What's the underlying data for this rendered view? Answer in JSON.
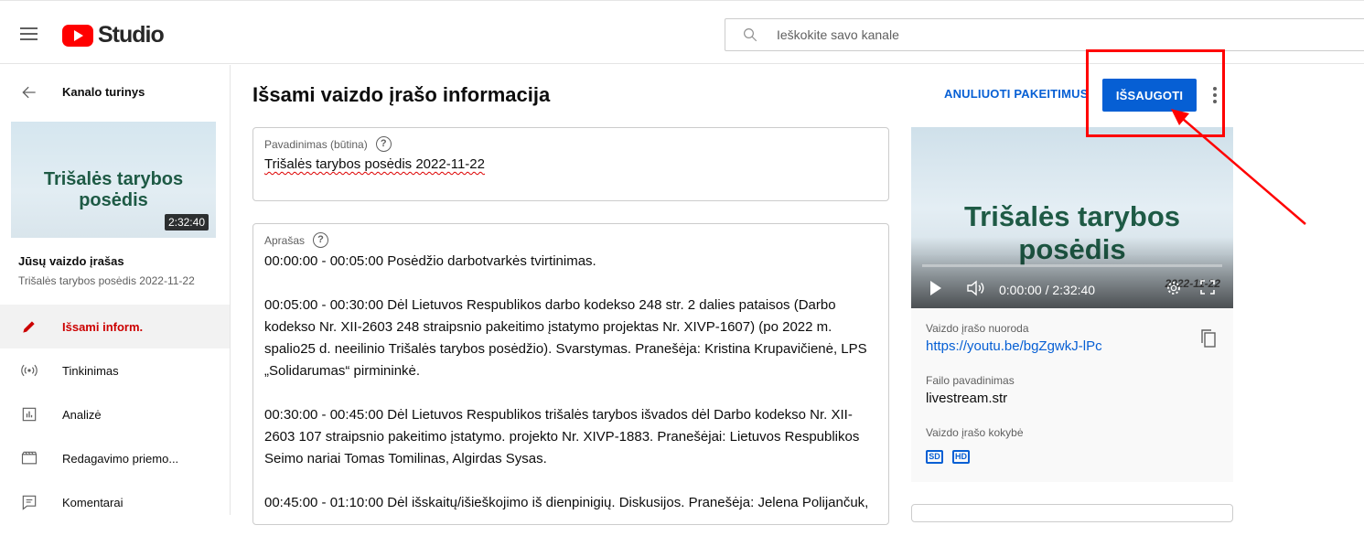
{
  "header": {
    "logo_text": "Studio",
    "search_placeholder": "Ieškokite savo kanale"
  },
  "sidebar": {
    "back_label": "Kanalo turinys",
    "thumbnail_title": "Trišalės tarybos posėdis",
    "thumbnail_duration": "2:32:40",
    "your_video_label": "Jūsų vaizdo įrašas",
    "video_title": "Trišalės tarybos posėdis 2022-11-22",
    "items": [
      {
        "label": "Išsami inform.",
        "icon": "pencil-icon",
        "active": true
      },
      {
        "label": "Tinkinimas",
        "icon": "broadcast-icon",
        "active": false
      },
      {
        "label": "Analizė",
        "icon": "analytics-icon",
        "active": false
      },
      {
        "label": "Redagavimo priemo...",
        "icon": "clapperboard-icon",
        "active": false
      },
      {
        "label": "Komentarai",
        "icon": "comment-icon",
        "active": false
      }
    ]
  },
  "main": {
    "page_title": "Išsami vaizdo įrašo informacija",
    "undo_label": "ANULIUOTI PAKEITIMUS",
    "save_label": "IŠSAUGOTI",
    "title_field": {
      "label": "Pavadinimas (būtina)",
      "value": "Trišalės tarybos posėdis 2022-11-22"
    },
    "description_field": {
      "label": "Aprašas",
      "paragraphs": [
        "00:00:00 - 00:05:00 Posėdžio darbotvarkės tvirtinimas.",
        "00:05:00 - 00:30:00 Dėl Lietuvos Respublikos darbo kodekso 248 str. 2 dalies pataisos (Darbo kodekso Nr. XII-2603 248 straipsnio pakeitimo įstatymo projektas Nr. XIVP-1607) (po 2022 m. spalio25 d. neeilinio Trišalės tarybos posėdžio). Svarstymas. Pranešėja: Kristina Krupavičienė, LPS „Solidarumas“ pirmininkė.",
        "00:30:00 - 00:45:00 Dėl Lietuvos Respublikos trišalės tarybos išvados dėl Darbo kodekso Nr. XII-2603 107 straipsnio pakeitimo įstatymo. projekto Nr. XIVP-1883. Pranešėjai: Lietuvos Respublikos Seimo nariai Tomas Tomilinas, Algirdas Sysas.",
        "00:45:00 - 01:10:00 Dėl išskaitų/išieškojimo iš dienpinigių. Diskusijos. Pranešėja: Jelena Polijančuk,"
      ]
    }
  },
  "player": {
    "video_title": "Trišalės tarybos posėdis",
    "video_date": "2022-11-22",
    "timecode": "0:00:00 / 2:32:40",
    "link_label": "Vaizdo įrašo nuoroda",
    "link_value": "https://youtu.be/bgZgwkJ-lPc",
    "filename_label": "Failo pavadinimas",
    "filename_value": "livestream.str",
    "quality_label": "Vaizdo įrašo kokybė",
    "quality_badges": [
      "SD",
      "HD"
    ]
  },
  "colors": {
    "accent": "#065fd4",
    "active_nav": "#cc0000",
    "annotation": "#ff0000"
  }
}
